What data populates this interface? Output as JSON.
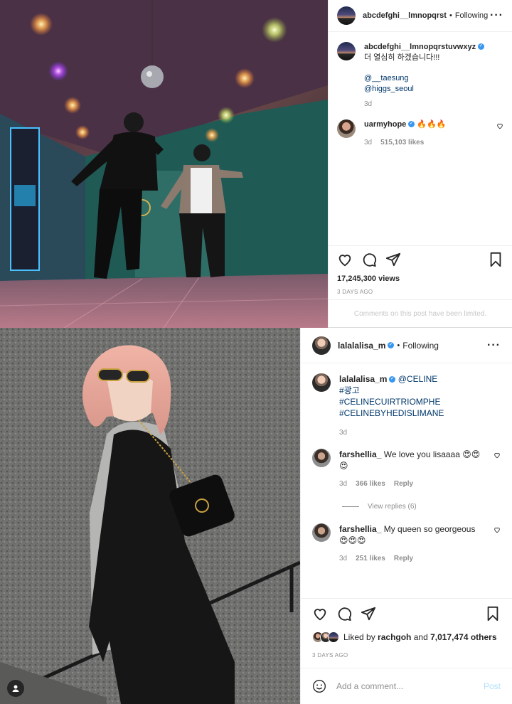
{
  "post1": {
    "username": "abcdefghi__lmnopqrst",
    "follow_status": "Following",
    "caption": {
      "username": "abcdefghi__lmnopqrstuvwxyz",
      "text": "더 열심히 하겠습니다!!!",
      "mention1": "@__taesung",
      "mention2": "@higgs_seoul",
      "time": "3d"
    },
    "comment": {
      "username": "uarmyhope",
      "text": "🔥🔥🔥",
      "time": "3d",
      "likes": "515,103 likes"
    },
    "views": "17,245,300 views",
    "ago": "3 DAYS AGO",
    "limited_notice": "Comments on this post have been limited."
  },
  "post2": {
    "username": "lalalalisa_m",
    "follow_status": "Following",
    "caption": {
      "username": "lalalalisa_m",
      "mention": "@CELINE",
      "line2": "#광고",
      "line3": "#CELINECUIRTRIOMPHE",
      "line4": "#CELINEBYHEDISLIMANE",
      "time": "3d"
    },
    "comments": [
      {
        "username": "farshellia_",
        "text": "We love you lisaaaa 😍😍😍",
        "time": "3d",
        "likes": "366 likes",
        "reply": "Reply"
      },
      {
        "username": "farshellia_",
        "text": "My queen so georgeous 😍😍😍",
        "time": "3d",
        "likes": "251 likes",
        "reply": "Reply"
      }
    ],
    "view_replies": "View replies (6)",
    "liked_by_prefix": "Liked by",
    "liked_by_user": "rachgoh",
    "liked_by_and": "and",
    "liked_by_others": "7,017,474 others",
    "ago": "3 DAYS AGO",
    "comment_placeholder": "Add a comment...",
    "post_label": "Post"
  },
  "colors": {
    "link": "#00376b",
    "verified": "#3897f0",
    "muted": "#8e8e8e",
    "post_disabled": "#b2dffc"
  },
  "icons": [
    "heart-icon",
    "comment-icon",
    "share-icon",
    "bookmark-icon",
    "more-icon",
    "smile-icon",
    "verified-icon",
    "person-tag-icon"
  ]
}
